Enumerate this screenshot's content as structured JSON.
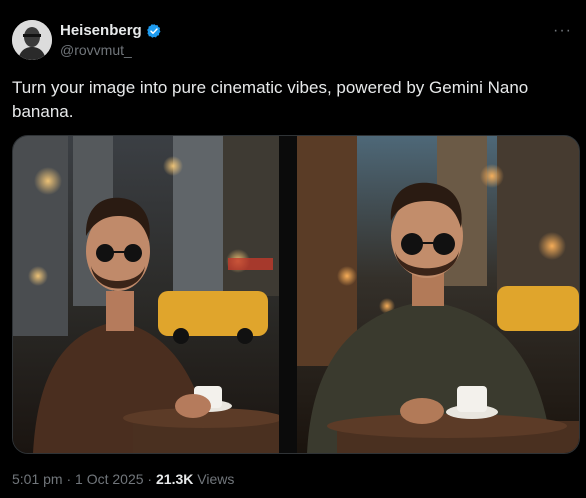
{
  "author": {
    "display_name": "Heisenberg",
    "handle": "@rovvmut_",
    "verified_icon": "verified-badge-icon",
    "verified_color": "#1d9bf0"
  },
  "more_icon": "more-options-icon",
  "tweet": {
    "text": "Turn your image into pure cinematic vibes, powered by Gemini Nano banana."
  },
  "media": {
    "images": [
      "photo-man-cafe-left",
      "photo-man-cafe-right"
    ]
  },
  "meta": {
    "time": "5:01 pm",
    "sep1": " · ",
    "date": "1 Oct 2025",
    "sep2": " · ",
    "views_count": "21.3K",
    "views_label": " Views"
  }
}
